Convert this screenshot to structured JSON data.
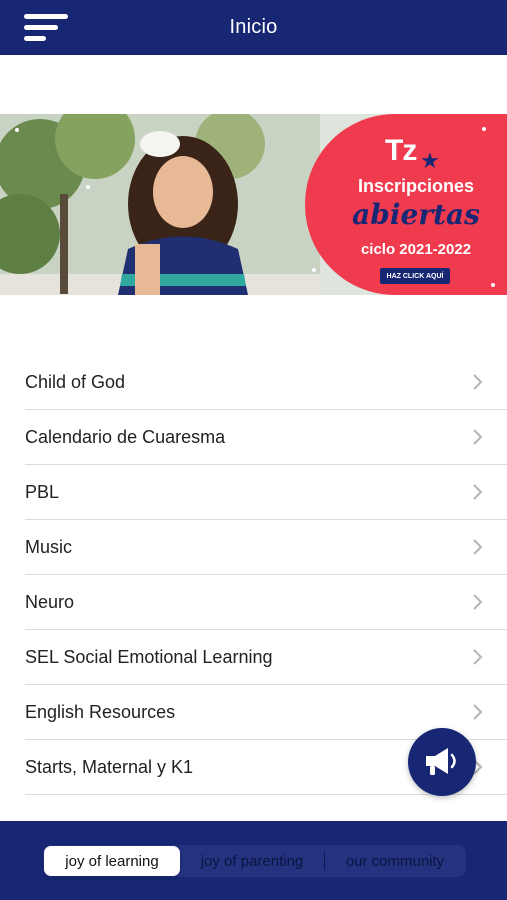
{
  "header": {
    "title": "Inicio",
    "background": "#172774",
    "menu_icon": "hamburger-menu-icon"
  },
  "banner": {
    "logo": "Tz",
    "headline": "Inscripciones",
    "highlight": "abiertas",
    "cycle": "ciclo 2021-2022",
    "cta": "HAZ CLICK AQUÍ",
    "accent_color": "#f03b4f"
  },
  "menu": {
    "items": [
      {
        "label": "Child of God"
      },
      {
        "label": "Calendario de Cuaresma"
      },
      {
        "label": "PBL"
      },
      {
        "label": "Music"
      },
      {
        "label": "Neuro"
      },
      {
        "label": "SEL Social Emotional Learning"
      },
      {
        "label": "English Resources"
      },
      {
        "label": "Starts, Maternal y K1"
      }
    ],
    "chevron_icon": "chevron-right-icon"
  },
  "fab": {
    "icon": "megaphone-icon"
  },
  "tabs": {
    "items": [
      {
        "label": "joy of learning",
        "selected": true
      },
      {
        "label": "joy of parenting",
        "selected": false
      },
      {
        "label": "our community",
        "selected": false
      }
    ]
  }
}
